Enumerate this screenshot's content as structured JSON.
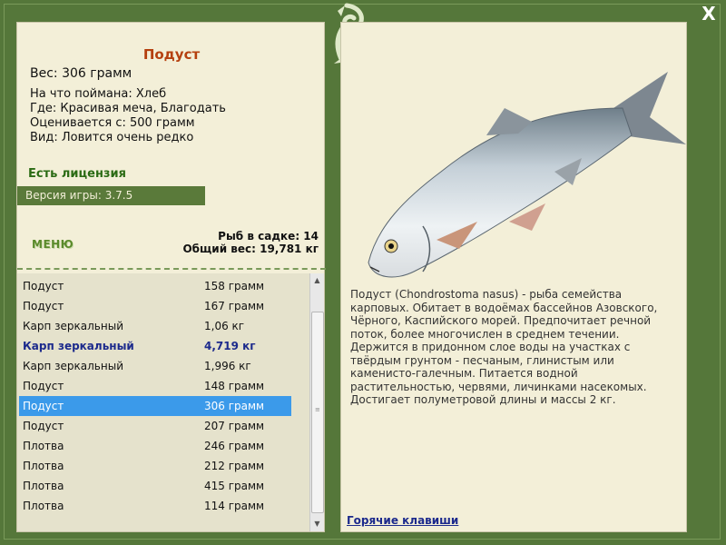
{
  "close": "X",
  "fish": {
    "title": "Подуст",
    "weight": "Вес: 306 грамм",
    "lines": [
      "На что поймана: Хлеб",
      "Где: Красивая меча, Благодать",
      "Оценивается с: 500 грамм",
      "Вид: Ловится очень редко"
    ]
  },
  "license": "Есть лицензия",
  "version": "Версия игры: 3.7.5",
  "menu": "МЕНЮ",
  "stats": {
    "count": "Рыб в садке: 14",
    "total": "Общий вес: 19,781 кг"
  },
  "catch_list": [
    {
      "name": "Подуст",
      "weight": "158 грамм",
      "style": ""
    },
    {
      "name": "Подуст",
      "weight": "167 грамм",
      "style": ""
    },
    {
      "name": "Карп зеркальный",
      "weight": "1,06 кг",
      "style": ""
    },
    {
      "name": "Карп зеркальный",
      "weight": "4,719 кг",
      "style": "bold"
    },
    {
      "name": "Карп зеркальный",
      "weight": "1,996 кг",
      "style": ""
    },
    {
      "name": "Подуст",
      "weight": "148 грамм",
      "style": ""
    },
    {
      "name": "Подуст",
      "weight": "306 грамм",
      "style": "selected"
    },
    {
      "name": "Подуст",
      "weight": "207 грамм",
      "style": ""
    },
    {
      "name": "Плотва",
      "weight": "246 грамм",
      "style": ""
    },
    {
      "name": "Плотва",
      "weight": "212 грамм",
      "style": ""
    },
    {
      "name": "Плотва",
      "weight": "415 грамм",
      "style": ""
    },
    {
      "name": "Плотва",
      "weight": "114 грамм",
      "style": ""
    }
  ],
  "description": "Подуст (Chondrostoma nasus) - рыба семейства карповых. Обитает в водоёмах бассейнов Азовского, Чёрного, Каспийского морей. Предпочитает речной поток, более многочислен в среднем течении. Держится в придонном слое воды на участках с твёрдым грунтом - песчаным, глинистым или каменисто-галечным. Питается водной растительностью, червями, личинками насекомых. Достигает полуметровой длины и массы 2 кг.",
  "hotkeys": "Горячие клавиши",
  "icons": {
    "close": "close-icon",
    "logo": "fish-logo-icon",
    "scroll_up": "scroll-up-icon",
    "scroll_down": "scroll-down-icon"
  },
  "colors": {
    "frame": "#55773a",
    "panel": "#f3efd8",
    "title": "#b5400f",
    "license": "#2b6b14",
    "selected": "#3b9aea",
    "highlight": "#1c2a8c"
  }
}
